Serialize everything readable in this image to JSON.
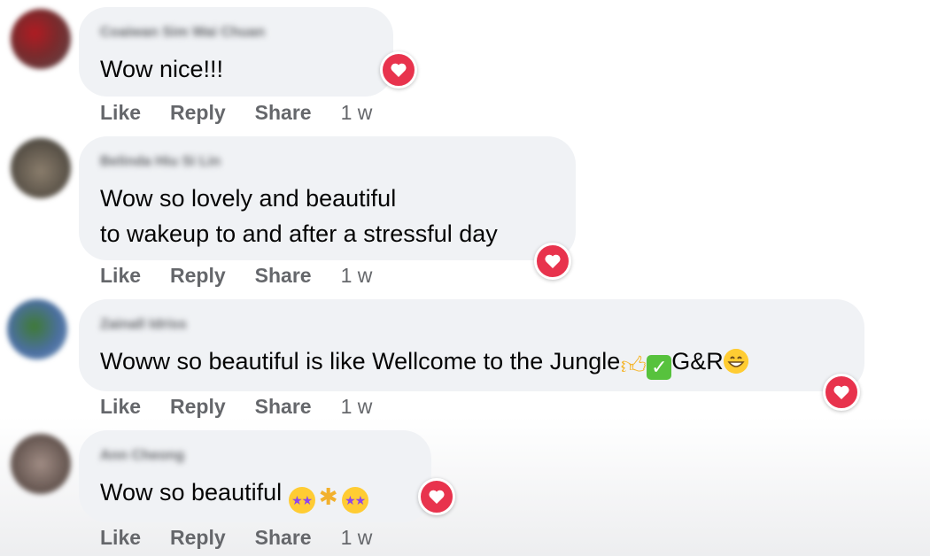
{
  "actions": {
    "like": "Like",
    "reply": "Reply",
    "share": "Share"
  },
  "comments": [
    {
      "author": "Coaiwan Sim Wai Chuan",
      "text": "Wow nice!!!",
      "time": "1 w",
      "reaction": "heart"
    },
    {
      "author": "Belinda Hiu Si Lin",
      "lines": [
        "Wow so lovely and beautiful",
        "to wakeup to and after a stressful day"
      ],
      "time": "1 w",
      "reaction": "heart"
    },
    {
      "author": "Zainall Idriss",
      "text": "Woww so beautiful is like Wellcome to the Jungle",
      "text_after": "G&R",
      "time": "1 w",
      "reaction": "heart"
    },
    {
      "author": "Ann Cheong",
      "text": "Wow so beautiful",
      "time": "1 w",
      "reaction": "heart"
    }
  ],
  "colors": {
    "heart": "#e8334d",
    "bubble": "#f0f2f5",
    "meta": "#65676b"
  }
}
